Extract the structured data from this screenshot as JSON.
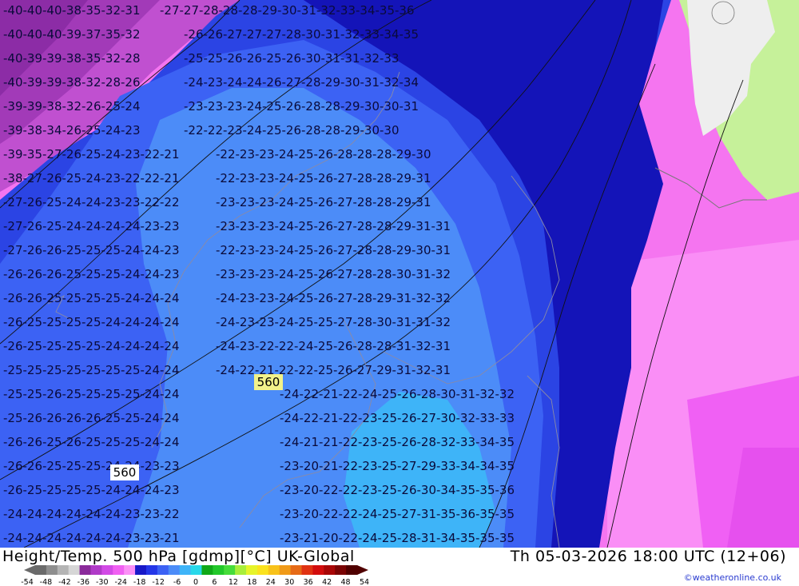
{
  "header": {
    "title": "Height/Temp. 500 hPa [gdmp][°C] UK-Global",
    "valid_time": "Th 05-03-2026 18:00 UTC (12+06)"
  },
  "credit": "©weatheronline.co.uk",
  "color_scale": {
    "labels": [
      "-54",
      "-48",
      "-42",
      "-36",
      "-30",
      "-24",
      "-18",
      "-12",
      "-6",
      "0",
      "6",
      "12",
      "18",
      "24",
      "30",
      "36",
      "42",
      "48",
      "54"
    ],
    "colors": [
      "#6a6a6a",
      "#8e8e8e",
      "#b4b4b4",
      "#d6d6d6",
      "#8a2a9a",
      "#b03ac8",
      "#d24ae6",
      "#f060f2",
      "#fb90f6",
      "#1818c8",
      "#2436e8",
      "#3c62f4",
      "#4c8cf8",
      "#3eb4f8",
      "#28d8ea",
      "#10a818",
      "#22c82a",
      "#46dc3a",
      "#a8ee3a",
      "#e6f42a",
      "#fae21e",
      "#f8c21a",
      "#f09a18",
      "#e66a16",
      "#e03212",
      "#d20c0c",
      "#a80606",
      "#7a0303",
      "#500000"
    ]
  },
  "map": {
    "height_contour_labels": [
      "560",
      "560"
    ]
  }
}
